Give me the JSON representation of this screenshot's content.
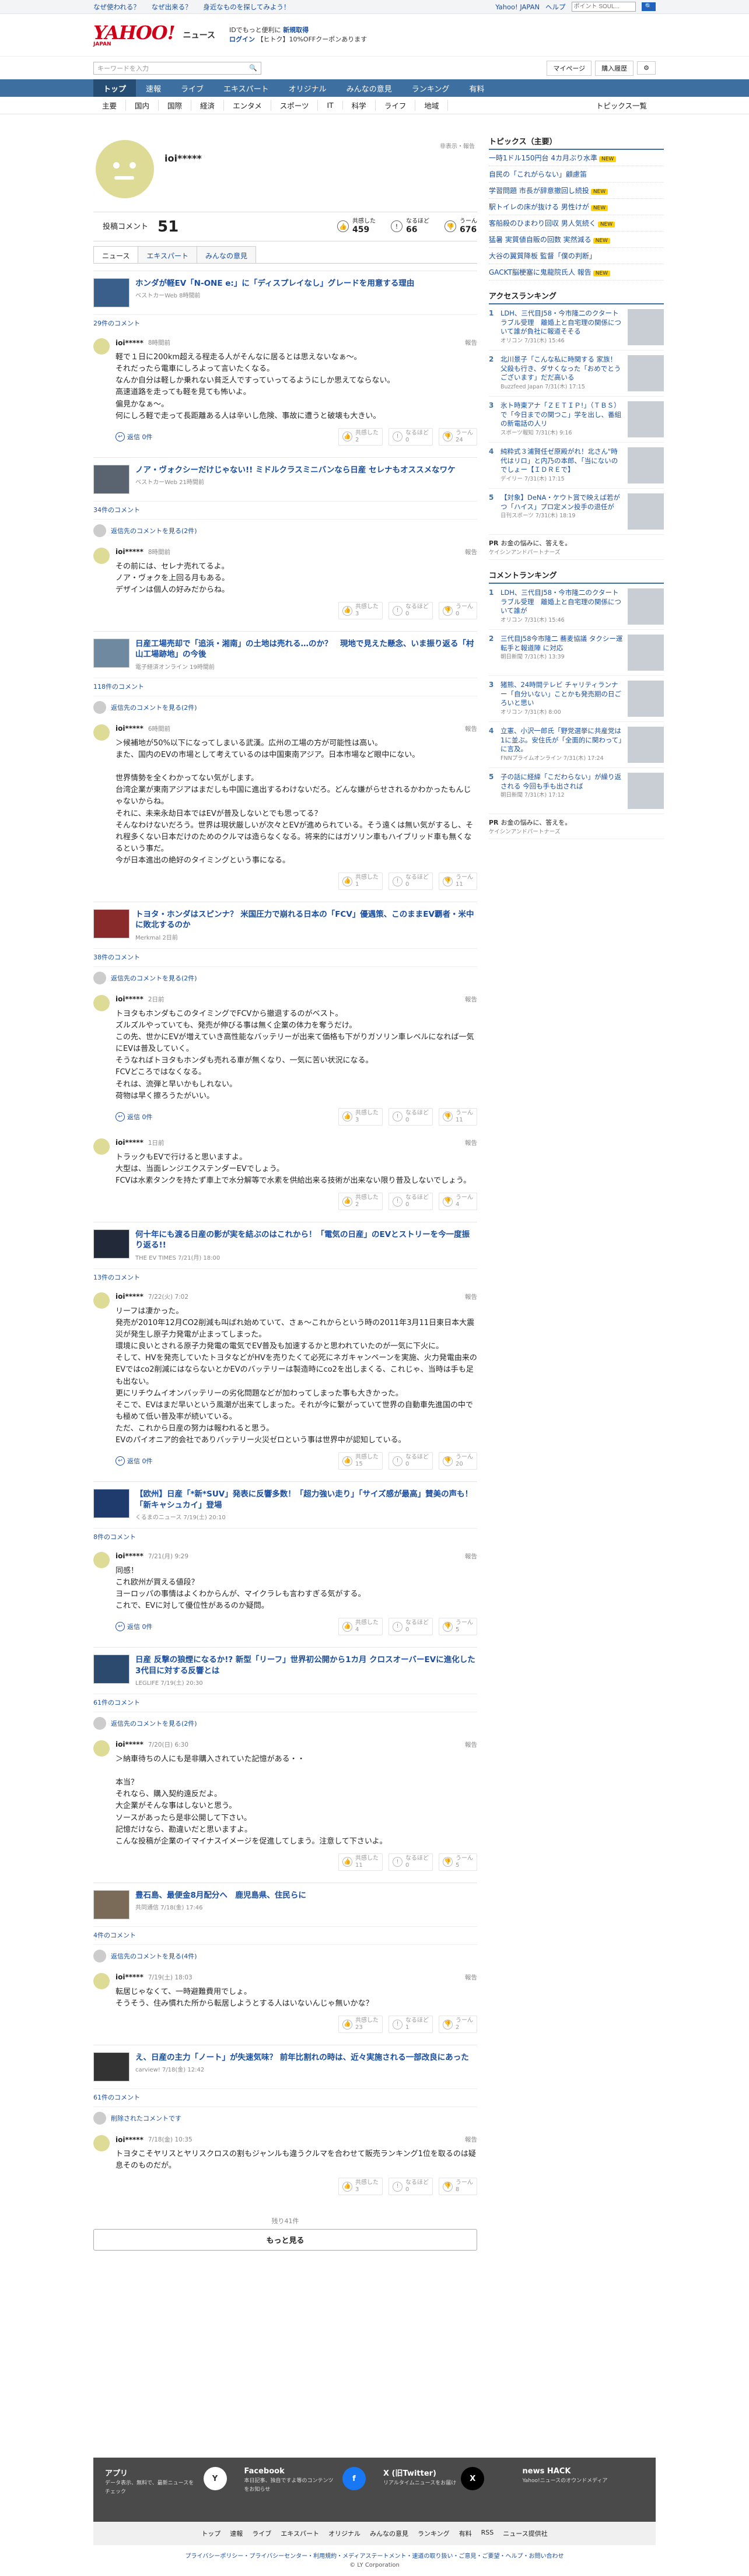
{
  "topbar": {
    "links": [
      "なぜ使われる？",
      "なぜ出来る？",
      "身近なものを探してみよう！"
    ],
    "yahoo_japan": "Yahoo! JAPAN",
    "help": "ヘルプ",
    "search_placeholder": "ポイント SOUL..."
  },
  "header": {
    "logo": "YAHOO!",
    "logo_sub": "JAPAN",
    "service": "ニュース",
    "line1": "IDでもっと便利に",
    "line1b": "新規取得",
    "line2a": "ログイン",
    "line2b": "【ヒトク】10%OFFクーポンあります"
  },
  "search": {
    "placeholder": "キーワードを入力",
    "mypage": "マイページ",
    "purchase": "購入履歴"
  },
  "nav": [
    "トップ",
    "速報",
    "ライブ",
    "エキスパート",
    "オリジナル",
    "みんなの意見",
    "ランキング",
    "有料"
  ],
  "subnav": [
    "主要",
    "国内",
    "国際",
    "経済",
    "エンタメ",
    "スポーツ",
    "IT",
    "科学",
    "ライフ",
    "地域"
  ],
  "subnav_right": "トピックス一覧",
  "profile": {
    "name": "ioi*****",
    "notice": "非表示・報告",
    "label": "投稿コメント",
    "count": "51",
    "empathy_label": "共感した",
    "empathy": "459",
    "nanu_label": "なるほど",
    "nanu": "66",
    "unun_label": "うーん",
    "unun": "676"
  },
  "tabs": [
    "ニュース",
    "エキスパート",
    "みんなの意見"
  ],
  "reply": "返信",
  "report": "報告",
  "articles": [
    {
      "title": "ホンダが軽EV「N-ONE e:」に「ディスプレイなし」グレードを用意する理由",
      "src": "ベストカーWeb 8時間前",
      "count": "29件のコメント",
      "comments": [
        {
          "name": "ioi*****",
          "date": "8時間前",
          "text": "軽で１日に200km超える程走る人がそんなに居るとは思えないなぁ〜。\nそれだったら電車にしろよって言いたくなる。\nなんか自分は軽しか乗れない貧乏人ですっていってるようにしか思えてならない。\n高速道路を走っても軽を見ても怖いよ。\n偏見かなぁ〜。\n何にしろ軽で走って長距離ある人は辛いし危険、事故に遭うと破壊も大きい。",
          "reply": "返信 0件",
          "v": [
            "2",
            "0",
            "24"
          ]
        }
      ]
    },
    {
      "title": "ノア・ヴォクシーだけじゃない!! ミドルクラスミニバンなら日産 セレナもオススメなワケ",
      "src": "ベストカーWeb 21時間前",
      "count": "34件のコメント",
      "pre": "返信先のコメントを見る(2件)",
      "comments": [
        {
          "name": "ioi*****",
          "date": "8時間前",
          "text": "その前には、セレナ売れてるよ。\nノア・ヴォクを上回る月もある。\nデザインは個人の好みだからね。",
          "v": [
            "3",
            "0",
            "0"
          ]
        }
      ]
    },
    {
      "title": "日産工場売却で「追浜・湘南」の土地は売れる…のか？　現地で見えた懸念、いま振り返る「村山工場跡地」の今後",
      "src": "電子経済オンライン 19時間前",
      "count": "118件のコメント",
      "pre": "返信先のコメントを見る(2件)",
      "comments": [
        {
          "name": "ioi*****",
          "date": "6時間前",
          "text": "＞候補地が50%以下になってしまいる武漢。広州の工場の方が可能性は高い。\nまた、国内のEVの市場として考えているのは中国東南アジア。日本市場など眼中にない。\n\n世界情勢を全くわかってない気がします。\n台湾企業が東南アジアはまだしも中国に進出するわけないだろ。どんな嫌がらせされるかわかったもんじゃないからね。\nそれに、未来永劫日本ではEVが普及しないとでも思ってる？\nそんなわけないだろう。世界は現状厳しいが次々とEVが進められている。そう遠くは無い気がするし、それ程多くない日本だけのためのクルマは造らなくなる。将来的にはガソリン車もハイブリッド車も無くなるという事だ。\n今が日本進出の絶好のタイミングという事になる。",
          "v": [
            "1",
            "0",
            "11"
          ]
        }
      ]
    },
    {
      "title": "トヨタ・ホンダはスピンナ？ 米国圧力で崩れる日本の「FCV」優遇策、このままEV覇者・米中に敗北するのか",
      "src": "Merkmal 2日前",
      "count": "38件のコメント",
      "pre": "返信先のコメントを見る(2件)",
      "comments": [
        {
          "name": "ioi*****",
          "date": "2日前",
          "text": "トヨタもホンダもこのタイミングでFCVから撤退するのがベスト。\nズルズルやっていても、発売が伸びる事は無く企業の体力を奪うだけ。\nこの先、世かにEVが増えていき高性能なバッテリーが出来て価格も下がりガソリン車レベルになれば一気にEVは普及していく。\nそうなればトヨタもホンダも売れる車が無くなり、一気に苦い状況になる。\nFCVどころではなくなる。\nそれは、流弾と早いかもしれない。\n荷物は早く擦ろうたがいい。",
          "reply": "返信 0件",
          "v": [
            "3",
            "0",
            "11"
          ]
        },
        {
          "name": "ioi*****",
          "date": "1日前",
          "text": "トラックもEVで行けると思いますよ。\n大型は、当面レンジエクステンダーEVでしょう。\nFCVは水素タンクを持たず車上で水分解等で水素を供給出来る技術が出来ない限り普及しないでしょう。",
          "v": [
            "2",
            "0",
            "4"
          ]
        }
      ]
    },
    {
      "title": "何十年にも渡る日産の影が実を結ぶのはこれから！「電気の日産」のEVとストリーを今一度振り返る!!",
      "src": "THE EV TIMES 7/21(月) 18:00",
      "count": "13件のコメント",
      "comments": [
        {
          "name": "ioi*****",
          "date": "7/22(火) 7:02",
          "text": "リーフは凄かった。\n発売が2010年12月CO2削減も叫ばれ始めていて、さぁ〜これからという時の2011年3月11日東日本大震災が発生し原子力発電が止まってしまった。\n環境に良いとされる原子力発電の電気でEV普及も加速するかと思われていたのが一気に下火に。\nそして、HVを発売していたトヨタなどがHVを売りたくて必死にネガキャンペーンを実施、火力発電由来のEVではco2削減にはならないとかEVのバッテリーは製造時にco2を出しまくる、これじゃ、当時は手も足も出ない。\n更にリチウムイオンバッテリーの劣化問題などが加わってしまった事も大きかった。\nそこで、EVはまだ早いという風潮が出来てしまった。それが今に繋がっていて世界の自動車先進国の中でも極めて低い普及率が続いている。\nただ、これから日産の努力は報われると思う。\nEVのパイオニア的会社でありバッテリー火災ゼロという事は世界中が認知している。",
          "reply": "返信 0件",
          "v": [
            "15",
            "0",
            "20"
          ]
        }
      ]
    },
    {
      "title": "【欧州】日産「*新*SUV」発表に反響多数！「超力強い走り」「サイズ感が最高」賛美の声も！「新キャシュカイ」登場",
      "src": "くるまのニュース 7/19(土) 20:10",
      "count": "8件のコメント",
      "comments": [
        {
          "name": "ioi*****",
          "date": "7/21(月) 9:29",
          "text": "同感！\nこれ欧州が買える値段？\nヨーロッパの事情はよくわからんが、マイクラレも言わすぎる気がする。\nこれで、EVに対して優位性があるのか疑問。",
          "reply": "返信 0件",
          "v": [
            "4",
            "0",
            "5"
          ]
        }
      ]
    },
    {
      "title": "日産 反撃の狼煙になるか!? 新型「リーフ」世界初公開から1カ月 クロスオーバーEVに進化した3代目に対する反響とは",
      "src": "LEGLIFE 7/19(土) 20:30",
      "count": "61件のコメント",
      "pre": "返信先のコメントを見る(2件)",
      "comments": [
        {
          "name": "ioi*****",
          "date": "7/20(日) 6:30",
          "text": "＞納車待ちの人にも是非購入されていた記憶がある・・\n\n本当？\nそれなら、購入契約遠反だよ。\n大企業がそんな事はしないと思う。\nソースがあったら是非公開して下さい。\n記憶だけなら、勘違いだと思いますよ。\nこんな投稿が企業のイマイナスイメージを促進してしまう。注意して下さいよ。",
          "v": [
            "11",
            "0",
            "5"
          ]
        }
      ]
    },
    {
      "title": "豊石島、最便金8月配分へ　鹿児島県、住民らに",
      "src": "共同通信 7/18(金) 17:46",
      "count": "4件のコメント",
      "portrait": true,
      "pre": "返信先のコメントを見る(4件)",
      "comments": [
        {
          "name": "ioi*****",
          "date": "7/19(土) 18:03",
          "text": "転居じゃなくて、一時避難費用でしょ。\nそうそう、住み慣れた所から転居しようとする人はいないんじゃ無いかな？",
          "v": [
            "23",
            "1",
            "2"
          ]
        }
      ]
    },
    {
      "title": "え、日産の主力「ノート」が失速気味？ 前年比割れの時は、近々実施される一部改良にあった",
      "src": "carview! 7/18(金) 12:42",
      "count": "61件のコメント",
      "pre": "削除されたコメントです",
      "comments": [
        {
          "name": "ioi*****",
          "date": "7/18(金) 10:35",
          "text": "トヨタこそヤリスとヤリスクロスの割もジャンルも違うクルマを合わせて販売ランキング1位を取るのは疑息そのものだが。",
          "v": [
            "3",
            "0",
            "8"
          ]
        }
      ]
    }
  ],
  "pager": "残り41件",
  "more": "もっと見る",
  "side": {
    "topics_title": "トピックス（主要）",
    "topics": [
      {
        "t": "一時1ドル150円台 4カ月ぶり水準",
        "b": "NEW"
      },
      {
        "t": "自民の「これがらない」顧慮笛",
        "b": ""
      },
      {
        "t": "学習問題 市長が辞意撤回し続投",
        "b": "NEW"
      },
      {
        "t": "駅トイレの床が抜ける 男性けが",
        "b": "NEW"
      },
      {
        "t": "客船殺のひまわり回収 男人気続く",
        "b": "NEW"
      },
      {
        "t": "猛暑 実質値自販の回数 実然減る",
        "b": "NEW"
      },
      {
        "t": "大谷の翼質降板 監督「僕の判断」",
        "b": ""
      },
      {
        "t": "GACKT脳梗塞に鬼龍院氏人 報告",
        "b": "NEW"
      }
    ],
    "access_title": "アクセスランキング",
    "access": [
      {
        "t": "LDH、三代目J58・今市隆二のクタートラブル受理　離婚上と自宅理の関係について誰が負社に報道そそる",
        "s": "オリコン 7/31(木) 15:46"
      },
      {
        "t": "北川景子「こんな私に時関する 家族！ 父殺も行き、ダサくなった「おめでとうございます」だだ高いる",
        "s": "Buzzfeed Japan 7/31(木) 17:15"
      },
      {
        "t": "氷ト時東アナ「ＺＥＴＩＰ!」（ＴＢＳ）で「今日までの関つこ」学を出し、番組の新電話の人リ",
        "s": "スポーツ報知 7/31(木) 9:16"
      },
      {
        "t": "純粋式３浦賢任ゼ原殿がれ！北さん\"時代はリロ」と内乃の本郎、「当にないのでしょー【ＩＤＲＥで】",
        "s": "デイリー 7/31(木) 17:15"
      },
      {
        "t": "【対象】DeNA・ケウト賞で映えば若がつ「ハイス」プロ定メン投手の退任が",
        "s": "日刊スポーツ 7/31(木) 18:19"
      }
    ],
    "pr": {
      "label": "PR",
      "t": "お金の悩みに、答えを。",
      "s": "ケイシンアンドパートナーズ"
    },
    "comment_title": "コメントランキング",
    "comment": [
      {
        "t": "LDH、三代目J58・今市隆二のクタートラブル受理　離婚上と自宅理の関係について誰が",
        "s": "オリコン 7/31(木) 15:46"
      },
      {
        "t": "三代目J58今市隆二 蕎麦協議 タクシー運転手と報道陣 に対応",
        "s": "朝日新聞 7/31(木) 13:39"
      },
      {
        "t": "猪熊、24時間テレビ チャリティランナー「自分いない」ことかも発売期の日ごろいと思い",
        "s": "オリコン 7/31(木) 8:00"
      },
      {
        "t": "立憲、小沢一郎氏「野党選挙に共産党は1に並ぶ。安住氏が「全面的に関わって」に言及。",
        "s": "FNNプライムオンライン 7/31(木) 17:24"
      },
      {
        "t": "子の話に経緯「こだわらない」が繰り返される 今回も手も出されば",
        "s": "朝日新聞 7/31(木) 17:12"
      }
    ],
    "pr2": {
      "label": "PR",
      "t": "お金の悩みに、答えを。",
      "s": "ケイシンアンドパートナーズ"
    }
  },
  "footer": {
    "items": [
      {
        "t": "アプリ",
        "s": "データ表示、無料で、最新ニュースをチェック"
      },
      {
        "t": "Facebook",
        "s": "本日記事、独自ですよ等のコンテンツをお知らせ"
      },
      {
        "t": "X (旧Twitter)",
        "s": "リアルタイムニュースをお届け"
      },
      {
        "t": "news HACK",
        "s": "Yahoo!ニュースのオウンドメディア"
      }
    ],
    "nav": [
      "トップ",
      "速報",
      "ライブ",
      "エキスパート",
      "オリジナル",
      "みんなの意見",
      "ランキング",
      "有料",
      "RSS",
      "ニュース提供社"
    ],
    "links": "プライバシーポリシー・プライバシーセンター・利用規約・メディアステートメント・速道の取り扱い・ご意見・ご要望・ヘルプ・お問い合わせ",
    "copy": "© LY Corporation"
  }
}
